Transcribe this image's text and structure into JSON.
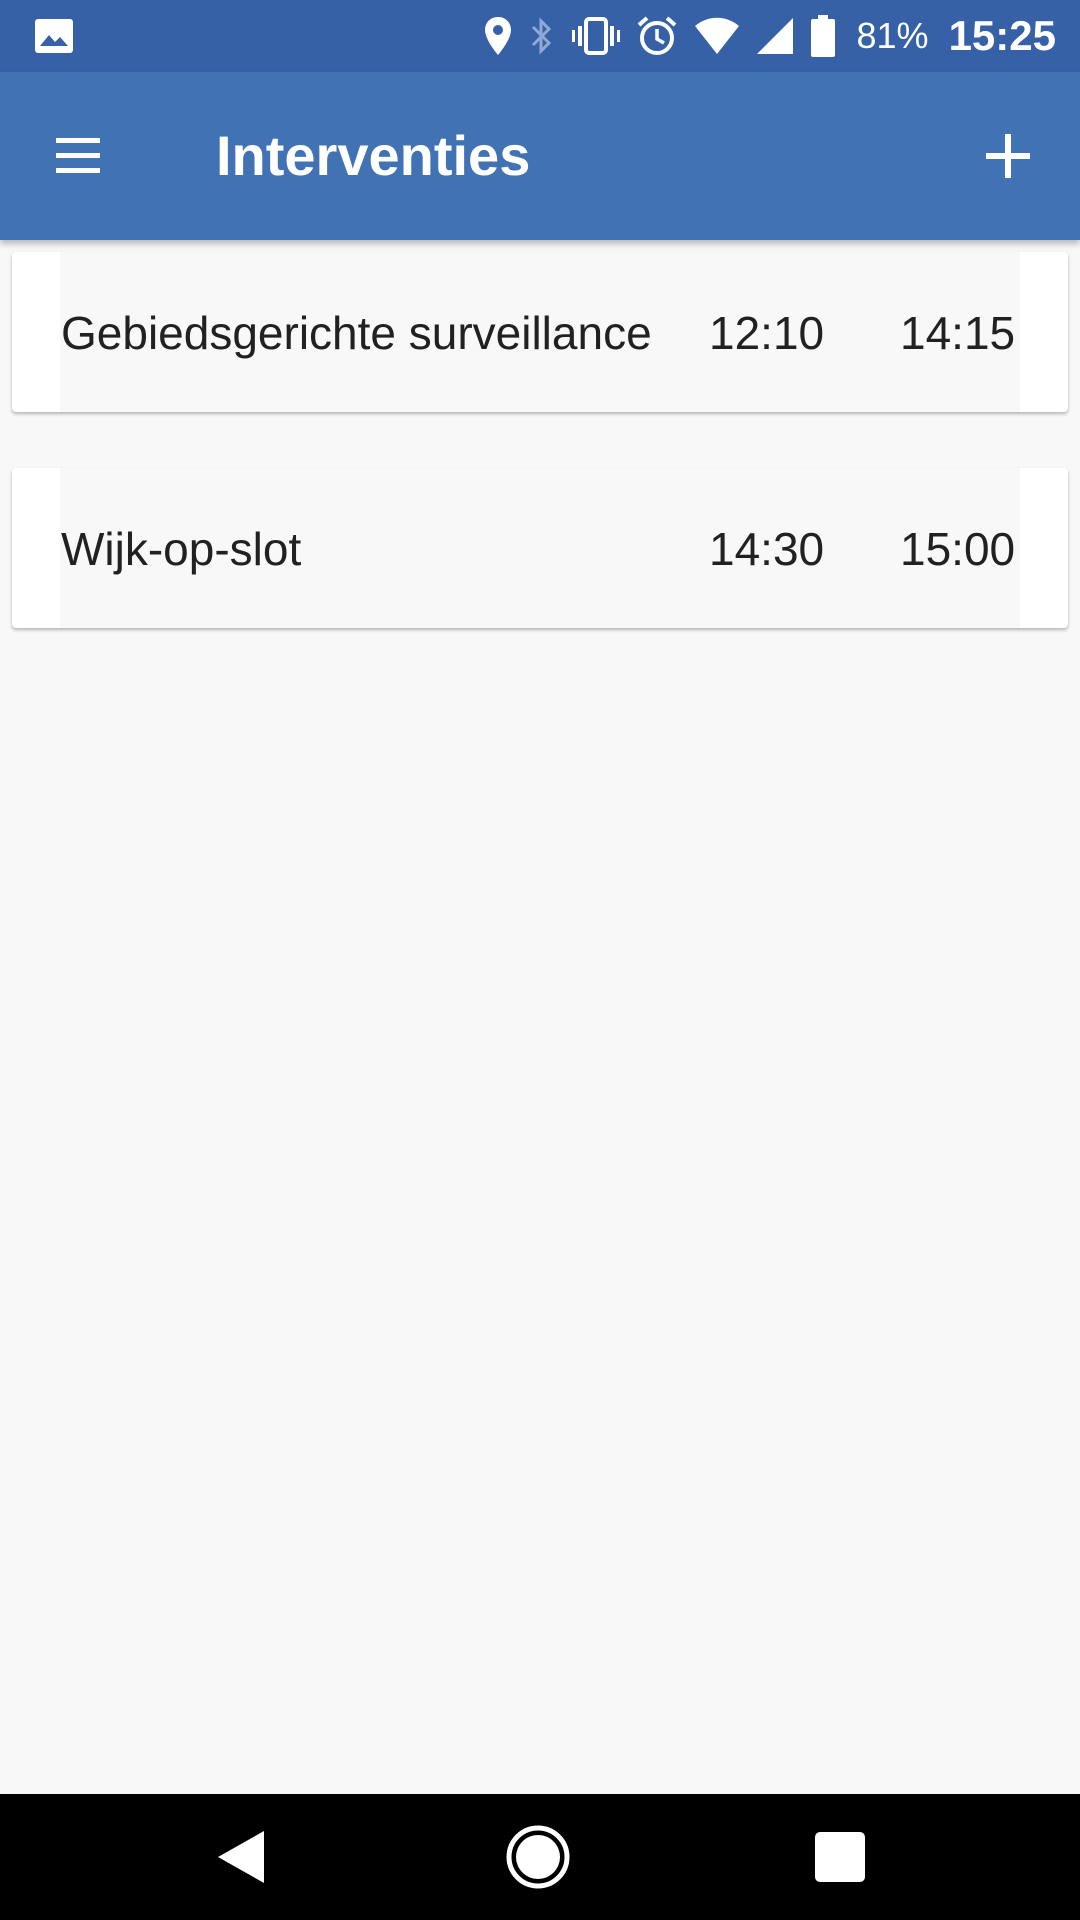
{
  "status_bar": {
    "icons": [
      "image-icon",
      "location-icon",
      "bluetooth-icon",
      "vibrate-icon",
      "alarm-icon",
      "wifi-icon",
      "signal-icon",
      "battery-icon"
    ],
    "battery_percent": "81%",
    "time": "15:25",
    "background": "#3661a6"
  },
  "app_bar": {
    "title": "Interventies",
    "menu_icon": "hamburger-menu-icon",
    "add_icon": "plus-icon",
    "background": "#4172b4"
  },
  "interventions": [
    {
      "name": "Gebiedsgerichte surveillance",
      "start": "12:10",
      "end": "14:15"
    },
    {
      "name": "Wijk-op-slot",
      "start": "14:30",
      "end": "15:00"
    }
  ],
  "nav_bar": {
    "icons": [
      "back-icon",
      "home-icon",
      "recents-icon"
    ]
  }
}
